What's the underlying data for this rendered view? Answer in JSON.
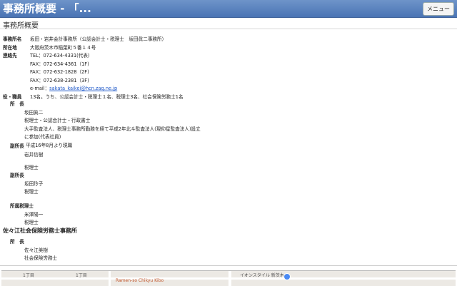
{
  "header": {
    "title": "事務所概要 - 「...",
    "menu_label": "メニュー"
  },
  "page_heading": "事務所概要",
  "info": {
    "name_label": "事務所名",
    "name_value": "坂田・岩井会計事務所（公認会計士・税理士　坂田眞二事務所）",
    "address_label": "所在地",
    "address_value": "大阪府茨木市稲葉町５番１４号",
    "contact_label": "連絡先",
    "tel": "TEL：072-634-4331(代表)",
    "fax1": "FAX：072-634-4361（1F)",
    "fax2": "FAX：072-632-1828（2F)",
    "fax3": "FAX：072-638-2381（3F)",
    "email_prefix": "e-mail：",
    "email": "sakata_kaikei@hcn.zaq.ne.jp",
    "staff_label": "役・職員",
    "staff_value": "13名。うち、公認会計士・税理士１名、税理士3名、社会保険労務士1名"
  },
  "director": {
    "title": "所　長",
    "name": "坂田眞二",
    "quals": "税理士・公認会計士・行政書士",
    "career1": "大手監査法人、税理士事務所勤務を経て平成2年北斗監査法人(現仰星監査法人)設立",
    "career2": "に参加(代表社員)",
    "career3": "平成16年8月より現職"
  },
  "deputy1": {
    "title": "副所長",
    "name": "岩井信樹",
    "qual": "税理士"
  },
  "deputy2": {
    "title": "副所長",
    "name": "坂田玲子",
    "qual": "税理士"
  },
  "staff_tax": {
    "title": "所属税理士",
    "name": "米澤陽一",
    "qual": "税理士"
  },
  "office2": {
    "title": "佐々江社会保険労務士事務所",
    "director_title": "所　長",
    "name": "佐々江美樹",
    "qual": "社会保険労務士"
  },
  "map": {
    "label1": "1丁目",
    "label2": "1丁目",
    "label3": "Ramen-so Chikyu Kibo",
    "label4": "イオンスタイル 新茨木"
  }
}
